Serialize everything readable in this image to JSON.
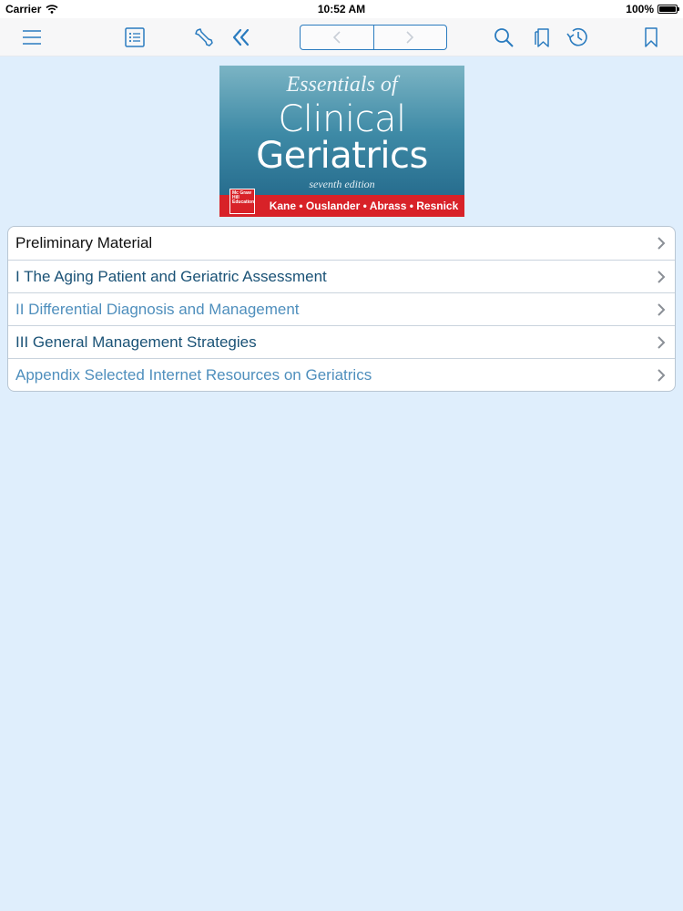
{
  "status_bar": {
    "carrier": "Carrier",
    "time": "10:52 AM",
    "battery": "100%"
  },
  "toolbar": {
    "icons": [
      "menu-icon",
      "contents-list-icon",
      "tools-icon",
      "collapse-icon",
      "back-icon",
      "forward-icon",
      "search-icon",
      "bookmarks-icon",
      "history-icon",
      "bookmark-icon"
    ],
    "accent_color": "#2a7bbf"
  },
  "book": {
    "title_line1": "Essentials of",
    "title_line2": "Clinical",
    "title_line3": "Geriatrics",
    "edition": "seventh edition",
    "authors": "Kane • Ouslander • Abrass • Resnick",
    "publisher_logo": "Mc Graw Hill Education"
  },
  "contents": [
    {
      "label": "Preliminary Material",
      "color": "#111111"
    },
    {
      "label": "I The Aging Patient and Geriatric Assessment",
      "color": "#1a5276"
    },
    {
      "label": "II Differential Diagnosis and Management",
      "color": "#4f8fbd"
    },
    {
      "label": "III General Management Strategies",
      "color": "#1a5276"
    },
    {
      "label": "Appendix Selected Internet Resources on Geriatrics",
      "color": "#4f8fbd"
    }
  ]
}
